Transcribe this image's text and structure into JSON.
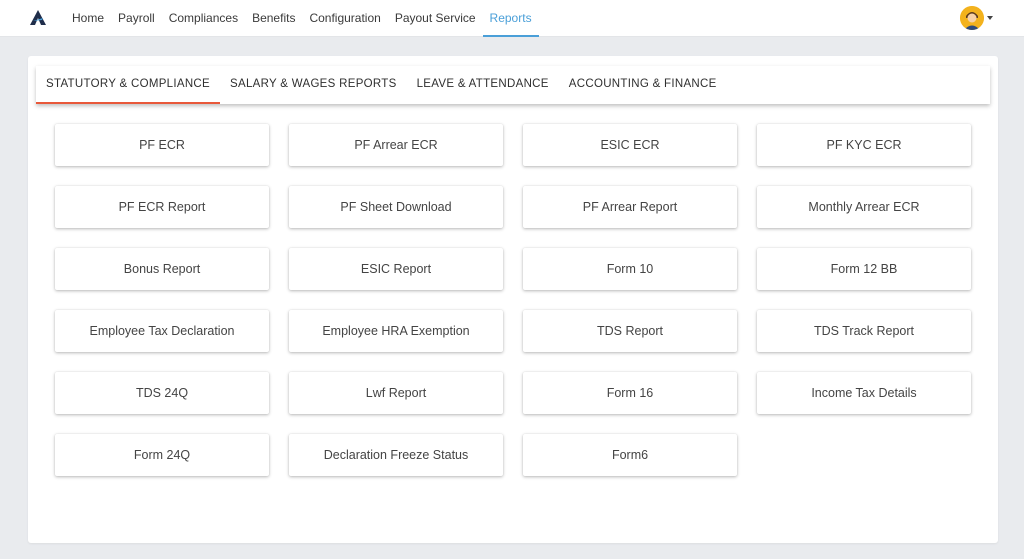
{
  "nav": {
    "items": [
      "Home",
      "Payroll",
      "Compliances",
      "Benefits",
      "Configuration",
      "Payout Service",
      "Reports"
    ],
    "active": "Reports"
  },
  "user": {
    "avatar_icon": "user-avatar-icon"
  },
  "tabs": {
    "items": [
      "STATUTORY & COMPLIANCE",
      "SALARY & WAGES REPORTS",
      "LEAVE & ATTENDANCE",
      "ACCOUNTING & FINANCE"
    ],
    "active": "STATUTORY & COMPLIANCE"
  },
  "reports": [
    "PF ECR",
    "PF Arrear ECR",
    "ESIC ECR",
    "PF KYC ECR",
    "PF ECR Report",
    "PF Sheet Download",
    "PF Arrear Report",
    "Monthly Arrear ECR",
    "Bonus Report",
    "ESIC Report",
    "Form 10",
    "Form 12 BB",
    "Employee Tax Declaration",
    "Employee HRA Exemption",
    "TDS Report",
    "TDS Track Report",
    "TDS 24Q",
    "Lwf Report",
    "Form 16",
    "Income Tax Details",
    "Form 24Q",
    "Declaration Freeze Status",
    "Form6"
  ],
  "colors": {
    "accent_blue": "#4a9fd8",
    "tab_underline": "#e8583a",
    "background": "#e9ebee"
  }
}
